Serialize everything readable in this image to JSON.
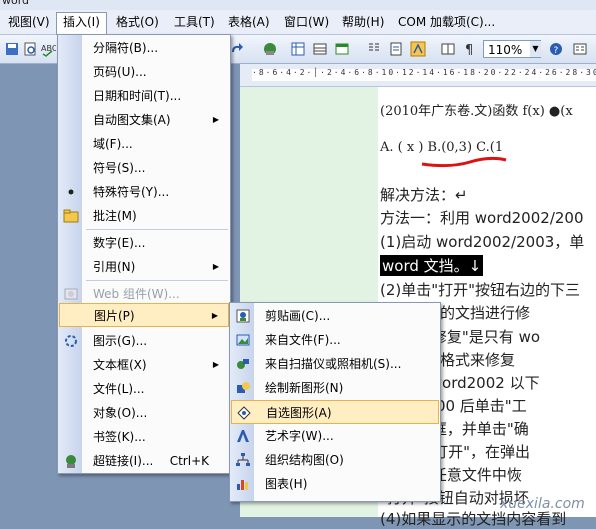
{
  "title_fragment": "word",
  "menubar": [
    {
      "label": "视图(V)"
    },
    {
      "label": "插入(I)"
    },
    {
      "label": "格式(O)"
    },
    {
      "label": "工具(T)"
    },
    {
      "label": "表格(A)"
    },
    {
      "label": "窗口(W)"
    },
    {
      "label": "帮助(H)"
    },
    {
      "label": "COM 加载项(C)..."
    }
  ],
  "toolbar": {
    "zoom_value": "110%",
    "zoom_arrow": "▼"
  },
  "ruler": {
    "ticks": "·8·6·4·2·│·2·4·6·8·10·12·14·16·18·20·22·24·26·28·30"
  },
  "insert_menu": [
    {
      "label": "分隔符(B)...",
      "icon": "",
      "arrow": false,
      "shortcut": ""
    },
    {
      "label": "页码(U)...",
      "icon": "",
      "arrow": false,
      "shortcut": ""
    },
    {
      "label": "日期和时间(T)...",
      "icon": "",
      "arrow": false,
      "shortcut": ""
    },
    {
      "label": "自动图文集(A)",
      "icon": "",
      "arrow": true,
      "shortcut": ""
    },
    {
      "label": "域(F)...",
      "icon": "",
      "arrow": false,
      "shortcut": ""
    },
    {
      "label": "符号(S)...",
      "icon": "",
      "arrow": false,
      "shortcut": ""
    },
    {
      "label": "特殊符号(Y)...",
      "icon": "special-symbol-icon",
      "arrow": false,
      "shortcut": ""
    },
    {
      "label": "批注(M)",
      "icon": "comment-icon",
      "arrow": false,
      "shortcut": ""
    },
    {
      "label": "数字(E)...",
      "icon": "",
      "arrow": false,
      "shortcut": ""
    },
    {
      "label": "引用(N)",
      "icon": "",
      "arrow": true,
      "shortcut": ""
    },
    {
      "label": "Web 组件(W)...",
      "icon": "web-component-icon",
      "arrow": false,
      "shortcut": "",
      "disabled": true
    },
    {
      "label": "图片(P)",
      "icon": "",
      "arrow": true,
      "shortcut": "",
      "selected": true
    },
    {
      "label": "图示(G)...",
      "icon": "diagram-icon",
      "arrow": false,
      "shortcut": ""
    },
    {
      "label": "文本框(X)",
      "icon": "",
      "arrow": true,
      "shortcut": ""
    },
    {
      "label": "文件(L)...",
      "icon": "",
      "arrow": false,
      "shortcut": ""
    },
    {
      "label": "对象(O)...",
      "icon": "",
      "arrow": false,
      "shortcut": ""
    },
    {
      "label": "书签(K)...",
      "icon": "",
      "arrow": false,
      "shortcut": ""
    },
    {
      "label": "超链接(I)...",
      "icon": "hyperlink-icon",
      "arrow": false,
      "shortcut": "Ctrl+K"
    }
  ],
  "picture_menu": [
    {
      "label": "剪贴画(C)...",
      "icon": "clipart-icon"
    },
    {
      "label": "来自文件(F)...",
      "icon": "from-file-icon"
    },
    {
      "label": "来自扫描仪或照相机(S)...",
      "icon": "scanner-icon"
    },
    {
      "label": "绘制新图形(N)",
      "icon": "new-drawing-icon"
    },
    {
      "label": "自选图形(A)",
      "icon": "autoshapes-icon",
      "selected": true
    },
    {
      "label": "艺术字(W)...",
      "icon": "wordart-icon"
    },
    {
      "label": "组织结构图(O)",
      "icon": "org-chart-icon"
    },
    {
      "label": "图表(H)",
      "icon": "chart-icon"
    }
  ],
  "document": {
    "header": "(2010年广东卷.文)函数 f(x) ●(x",
    "options": "A. (  ⅹ )     B.(0,3)   C.(1",
    "lines": [
      "解决方法：↵",
      "方法一：利用 word2002/200",
      "(1)启动 word2002/2003，单",
      "word 文挡。↓",
      "(2)单击\"打开\"按钮右边的下三",
      "     可对损坏的文挡进行修",
      "\"打开并修复\"是只有 wo",
      "  转换文挡格式来修复",
      "用的是 word2002 以下",
      "word2000 后单击\"工",
      "换\"复选框，并单击\"确",
      "\"文件---打开\"，在弹出",
      "选中\"从任意文件中恢",
      "\"打开\"按钮自动对损坏",
      "(4)如果显示的文挡内容看到"
    ]
  },
  "watermark": "xuexila.com"
}
